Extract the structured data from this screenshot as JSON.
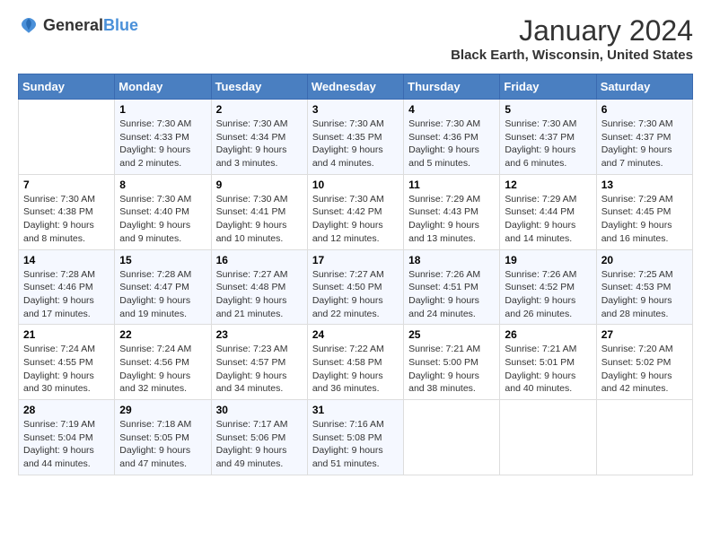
{
  "header": {
    "logo": {
      "general": "General",
      "blue": "Blue"
    },
    "title": "January 2024",
    "subtitle": "Black Earth, Wisconsin, United States"
  },
  "calendar": {
    "days_of_week": [
      "Sunday",
      "Monday",
      "Tuesday",
      "Wednesday",
      "Thursday",
      "Friday",
      "Saturday"
    ],
    "weeks": [
      [
        {
          "day": "",
          "sunrise": "",
          "sunset": "",
          "daylight": ""
        },
        {
          "day": "1",
          "sunrise": "Sunrise: 7:30 AM",
          "sunset": "Sunset: 4:33 PM",
          "daylight": "Daylight: 9 hours and 2 minutes."
        },
        {
          "day": "2",
          "sunrise": "Sunrise: 7:30 AM",
          "sunset": "Sunset: 4:34 PM",
          "daylight": "Daylight: 9 hours and 3 minutes."
        },
        {
          "day": "3",
          "sunrise": "Sunrise: 7:30 AM",
          "sunset": "Sunset: 4:35 PM",
          "daylight": "Daylight: 9 hours and 4 minutes."
        },
        {
          "day": "4",
          "sunrise": "Sunrise: 7:30 AM",
          "sunset": "Sunset: 4:36 PM",
          "daylight": "Daylight: 9 hours and 5 minutes."
        },
        {
          "day": "5",
          "sunrise": "Sunrise: 7:30 AM",
          "sunset": "Sunset: 4:37 PM",
          "daylight": "Daylight: 9 hours and 6 minutes."
        },
        {
          "day": "6",
          "sunrise": "Sunrise: 7:30 AM",
          "sunset": "Sunset: 4:37 PM",
          "daylight": "Daylight: 9 hours and 7 minutes."
        }
      ],
      [
        {
          "day": "7",
          "sunrise": "Sunrise: 7:30 AM",
          "sunset": "Sunset: 4:38 PM",
          "daylight": "Daylight: 9 hours and 8 minutes."
        },
        {
          "day": "8",
          "sunrise": "Sunrise: 7:30 AM",
          "sunset": "Sunset: 4:40 PM",
          "daylight": "Daylight: 9 hours and 9 minutes."
        },
        {
          "day": "9",
          "sunrise": "Sunrise: 7:30 AM",
          "sunset": "Sunset: 4:41 PM",
          "daylight": "Daylight: 9 hours and 10 minutes."
        },
        {
          "day": "10",
          "sunrise": "Sunrise: 7:30 AM",
          "sunset": "Sunset: 4:42 PM",
          "daylight": "Daylight: 9 hours and 12 minutes."
        },
        {
          "day": "11",
          "sunrise": "Sunrise: 7:29 AM",
          "sunset": "Sunset: 4:43 PM",
          "daylight": "Daylight: 9 hours and 13 minutes."
        },
        {
          "day": "12",
          "sunrise": "Sunrise: 7:29 AM",
          "sunset": "Sunset: 4:44 PM",
          "daylight": "Daylight: 9 hours and 14 minutes."
        },
        {
          "day": "13",
          "sunrise": "Sunrise: 7:29 AM",
          "sunset": "Sunset: 4:45 PM",
          "daylight": "Daylight: 9 hours and 16 minutes."
        }
      ],
      [
        {
          "day": "14",
          "sunrise": "Sunrise: 7:28 AM",
          "sunset": "Sunset: 4:46 PM",
          "daylight": "Daylight: 9 hours and 17 minutes."
        },
        {
          "day": "15",
          "sunrise": "Sunrise: 7:28 AM",
          "sunset": "Sunset: 4:47 PM",
          "daylight": "Daylight: 9 hours and 19 minutes."
        },
        {
          "day": "16",
          "sunrise": "Sunrise: 7:27 AM",
          "sunset": "Sunset: 4:48 PM",
          "daylight": "Daylight: 9 hours and 21 minutes."
        },
        {
          "day": "17",
          "sunrise": "Sunrise: 7:27 AM",
          "sunset": "Sunset: 4:50 PM",
          "daylight": "Daylight: 9 hours and 22 minutes."
        },
        {
          "day": "18",
          "sunrise": "Sunrise: 7:26 AM",
          "sunset": "Sunset: 4:51 PM",
          "daylight": "Daylight: 9 hours and 24 minutes."
        },
        {
          "day": "19",
          "sunrise": "Sunrise: 7:26 AM",
          "sunset": "Sunset: 4:52 PM",
          "daylight": "Daylight: 9 hours and 26 minutes."
        },
        {
          "day": "20",
          "sunrise": "Sunrise: 7:25 AM",
          "sunset": "Sunset: 4:53 PM",
          "daylight": "Daylight: 9 hours and 28 minutes."
        }
      ],
      [
        {
          "day": "21",
          "sunrise": "Sunrise: 7:24 AM",
          "sunset": "Sunset: 4:55 PM",
          "daylight": "Daylight: 9 hours and 30 minutes."
        },
        {
          "day": "22",
          "sunrise": "Sunrise: 7:24 AM",
          "sunset": "Sunset: 4:56 PM",
          "daylight": "Daylight: 9 hours and 32 minutes."
        },
        {
          "day": "23",
          "sunrise": "Sunrise: 7:23 AM",
          "sunset": "Sunset: 4:57 PM",
          "daylight": "Daylight: 9 hours and 34 minutes."
        },
        {
          "day": "24",
          "sunrise": "Sunrise: 7:22 AM",
          "sunset": "Sunset: 4:58 PM",
          "daylight": "Daylight: 9 hours and 36 minutes."
        },
        {
          "day": "25",
          "sunrise": "Sunrise: 7:21 AM",
          "sunset": "Sunset: 5:00 PM",
          "daylight": "Daylight: 9 hours and 38 minutes."
        },
        {
          "day": "26",
          "sunrise": "Sunrise: 7:21 AM",
          "sunset": "Sunset: 5:01 PM",
          "daylight": "Daylight: 9 hours and 40 minutes."
        },
        {
          "day": "27",
          "sunrise": "Sunrise: 7:20 AM",
          "sunset": "Sunset: 5:02 PM",
          "daylight": "Daylight: 9 hours and 42 minutes."
        }
      ],
      [
        {
          "day": "28",
          "sunrise": "Sunrise: 7:19 AM",
          "sunset": "Sunset: 5:04 PM",
          "daylight": "Daylight: 9 hours and 44 minutes."
        },
        {
          "day": "29",
          "sunrise": "Sunrise: 7:18 AM",
          "sunset": "Sunset: 5:05 PM",
          "daylight": "Daylight: 9 hours and 47 minutes."
        },
        {
          "day": "30",
          "sunrise": "Sunrise: 7:17 AM",
          "sunset": "Sunset: 5:06 PM",
          "daylight": "Daylight: 9 hours and 49 minutes."
        },
        {
          "day": "31",
          "sunrise": "Sunrise: 7:16 AM",
          "sunset": "Sunset: 5:08 PM",
          "daylight": "Daylight: 9 hours and 51 minutes."
        },
        {
          "day": "",
          "sunrise": "",
          "sunset": "",
          "daylight": ""
        },
        {
          "day": "",
          "sunrise": "",
          "sunset": "",
          "daylight": ""
        },
        {
          "day": "",
          "sunrise": "",
          "sunset": "",
          "daylight": ""
        }
      ]
    ]
  }
}
